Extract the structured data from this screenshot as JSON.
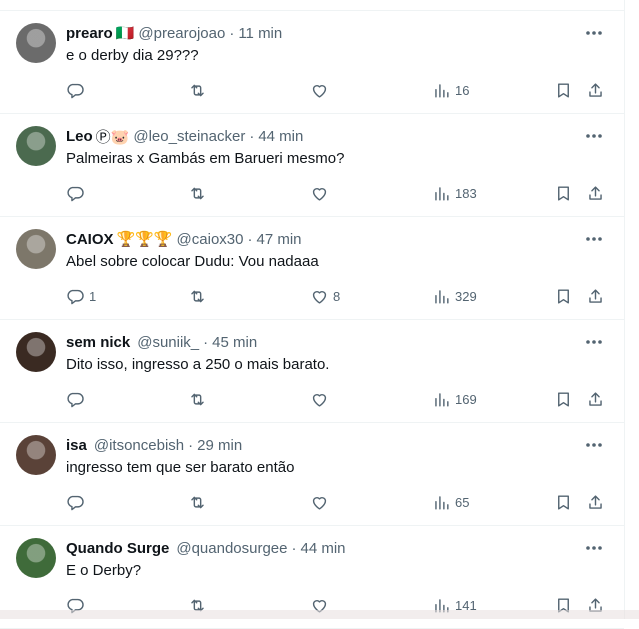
{
  "tweets": [
    {
      "name": "prearo",
      "name_emoji": "🇮🇹",
      "handle": "@prearojoao",
      "time": "11 min",
      "text": "e o derby dia 29???",
      "replies": "",
      "retweets": "",
      "likes": "",
      "views": "16",
      "avatar_color": "#6b6b6b"
    },
    {
      "name": "Leo",
      "name_emoji": "Ⓟ🐷",
      "handle": "@leo_steinacker",
      "time": "44 min",
      "text": "Palmeiras x Gambás em Barueri mesmo?",
      "replies": "",
      "retweets": "",
      "likes": "",
      "views": "183",
      "avatar_color": "#4b6a4f"
    },
    {
      "name": "CAIOX",
      "name_emoji": "🏆🏆🏆",
      "handle": "@caiox30",
      "time": "47 min",
      "text": "Abel sobre colocar Dudu: Vou nadaaa",
      "replies": "1",
      "retweets": "",
      "likes": "8",
      "views": "329",
      "avatar_color": "#7d776a"
    },
    {
      "name": "sem nick",
      "name_emoji": "",
      "handle": "@suniik_",
      "time": "45 min",
      "text": "Dito isso, ingresso a 250 o mais barato.",
      "replies": "",
      "retweets": "",
      "likes": "",
      "views": "169",
      "avatar_color": "#3a2a22"
    },
    {
      "name": "isa",
      "name_emoji": "",
      "handle": "@itsoncebish",
      "time": "29 min",
      "text": "ingresso tem que ser barato então",
      "replies": "",
      "retweets": "",
      "likes": "",
      "views": "65",
      "avatar_color": "#5a4238"
    },
    {
      "name": "Quando Surge",
      "name_emoji": "",
      "handle": "@quandosurgee",
      "time": "44 min",
      "text": "E o Derby?",
      "replies": "",
      "retweets": "",
      "likes": "",
      "views": "141",
      "avatar_color": "#3f6b3a"
    }
  ]
}
